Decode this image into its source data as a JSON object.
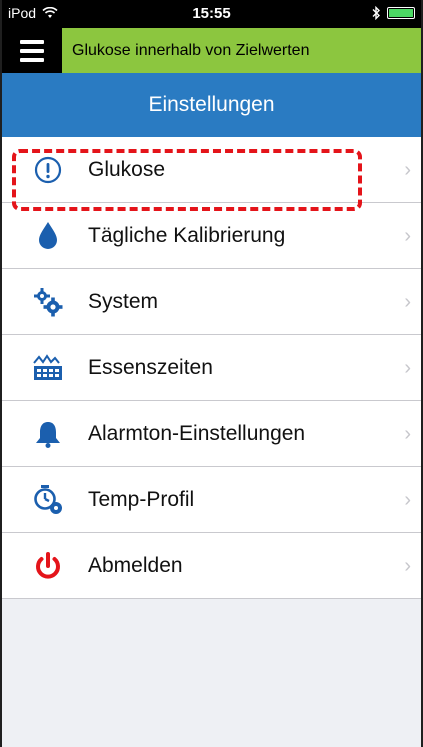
{
  "statusbar": {
    "device": "iPod",
    "time": "15:55"
  },
  "header": {
    "status_banner": "Glukose innerhalb von Zielwerten",
    "title": "Einstellungen"
  },
  "menu": {
    "items": [
      {
        "label": "Glukose",
        "icon": "exclamation-circle-icon"
      },
      {
        "label": "Tägliche Kalibrierung",
        "icon": "blood-drop-icon"
      },
      {
        "label": "System",
        "icon": "gears-icon"
      },
      {
        "label": "Essenszeiten",
        "icon": "meal-times-icon"
      },
      {
        "label": "Alarmton-Einstellungen",
        "icon": "bell-icon"
      },
      {
        "label": "Temp-Profil",
        "icon": "timer-profile-icon"
      },
      {
        "label": "Abmelden",
        "icon": "power-icon"
      }
    ]
  },
  "colors": {
    "banner_green": "#8cc63f",
    "title_blue": "#2a7bc2",
    "icon_blue": "#1b5fae",
    "power_red": "#e4141a",
    "highlight_red": "#e4141a"
  }
}
